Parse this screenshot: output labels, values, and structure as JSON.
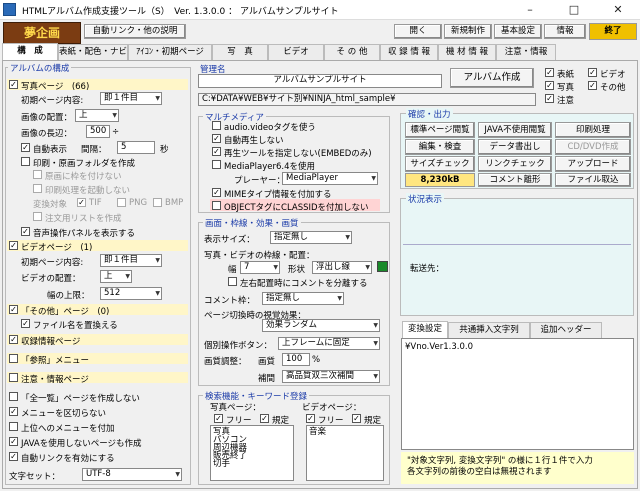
{
  "window": {
    "title": "HTMLアルバム作成支援ツール（S）　Ver. 1.3.0.0 ： アルバムサンプルサイト"
  },
  "toolbar": {
    "logo": "夢企画",
    "autolink_button": "自動リンク・他の説明",
    "open": "開く",
    "new": "新規制作",
    "basic": "基本設定",
    "info": "情報",
    "exit": "終了"
  },
  "tabs": [
    "構　成",
    "表紙・配色・ナビ",
    "ｱｲｺﾝ・初期ページ",
    "写　真",
    "ビデオ",
    "そ の 他",
    "収 録 情 報",
    "機 材 情 報",
    "注意・情報"
  ],
  "album": {
    "header": "アルバムの構成",
    "photo_page": "写真ページ　(66)",
    "initial_content_label": "初期ページ内容:",
    "initial_content": "即１件目",
    "image_position_label": "画像の配置：",
    "image_position": "上",
    "image_length_label": "画像の長辺：",
    "image_length": "500",
    "image_length_unit": "÷",
    "autoplay": "自動表示",
    "interval_label": "間隔：",
    "interval": "5",
    "interval_unit": "秒",
    "print_folder": "印刷・原画フォルダを作成",
    "no_original": "原画に枠を付けない",
    "no_print_start": "印刷処理を起動しない",
    "conv_label": "変換対象",
    "tif": "TIF",
    "png": "PNG",
    "bmp": "BMP",
    "order_list": "注文用リストを作成",
    "sound_panel": "音声操作パネルを表示する",
    "video_page": "ビデオページ　(1)",
    "video_initial_label": "初期ページ内容:",
    "video_initial": "即１件目",
    "video_position_label": "ビデオの配置：",
    "video_position": "上",
    "width_limit_label": "幅の上限：",
    "width_limit": "512",
    "other_page": "「その他」ページ　(0)",
    "replace_filename": "ファイル名を置換える",
    "record_page": "収録情報ページ",
    "reference_menu": "「参照」メニュー",
    "notice_page": "注意・情報ページ",
    "no_list_page": "「全一覧」ページを作成しない",
    "no_menu_separator": "メニューを区切らない",
    "add_to_top": "上位へのメニューを付加",
    "no_js": "JAVAを使用しないページも作成",
    "autolink_enable": "自動リンクを有効にする",
    "charset_label": "文字セット：",
    "charset": "UTF-8"
  },
  "mgmt": {
    "header": "管理名",
    "name": "アルバムサンプルサイト",
    "album_button": "アルバム作成",
    "path": "C:¥DATA¥WEB¥サイト別¥NINJA_html_sample¥"
  },
  "right_checks": {
    "cover": "表紙",
    "video": "ビデオ",
    "photo": "写真",
    "other": "その他",
    "notice": "注意"
  },
  "multimedia": {
    "header": "マルチメディア",
    "audio_video": "audio.videoタグを使う",
    "no_autoplay": "自動再生しない",
    "no_embed": "再生ツールを指定しない(EMBEDのみ)",
    "mp64": "MediaPlayer6.4を使用",
    "player_label": "プレーヤー：",
    "player": "MediaPlayer",
    "mime": "MIMEタイプ情報を付加する",
    "no_classid": "OBJECTタグにCLASSIDを付加しない"
  },
  "screen": {
    "header": "画面・枠線・効果・画質",
    "display_size_label": "表示サイズ：",
    "display_size": "指定無し",
    "frame_label": "写真・ビデオの枠線・配置：",
    "width_label": "幅",
    "width": "7",
    "shape_label": "形状",
    "shape": "浮出し線",
    "frame_color": "#1a8a2a",
    "split_comment": "左右配置時にコメントを分離する",
    "comment_frame_label": "コメント枠：",
    "comment_frame": "指定無し",
    "transition_label": "ページ切換時の視覚効果：",
    "transition": "効果ランダム",
    "comment_pos_label": "個別操作ボタン：",
    "comment_pos": "上フレームに固定",
    "quality_label": "画質調整：",
    "quality_sub": "画質",
    "quality": "100",
    "quality_unit": "%",
    "interp_label": "補間",
    "interp": "高品質双三次補間"
  },
  "search": {
    "header": "検索機能・キーワード登録",
    "photo_label": "写真ページ：",
    "video_label": "ビデオページ：",
    "free": "フリー",
    "fixed": "規定",
    "photo_keywords": [
      "写真",
      "パソコン",
      "周辺機器",
      "販売終了",
      "切手"
    ],
    "video_keywords": [
      "音楽"
    ]
  },
  "confirm": {
    "header": "確認・出力",
    "buttons": [
      "標準ページ閲覧",
      "JAVA不使用閲覧",
      "印刷処理",
      "編集・検査",
      "データ書出し",
      "CD/DVD作成",
      "サイズチェック",
      "リンクチェック",
      "アップロード"
    ],
    "size_value": "8,230kB",
    "comment_btn": "コメント離形",
    "import_btn": "ファイル取込"
  },
  "status": {
    "header": "状況表示",
    "dest_label": "転送先："
  },
  "bottomtabs": [
    "変換設定",
    "共通挿入文字列",
    "追加ヘッダー"
  ],
  "convert": {
    "text": "¥Vno.Ver1.3.0.0",
    "note": "\"対象文字列, 変換文字列\" の様に１行１件で入力\n各文字列の前後の空白は無視されます"
  }
}
